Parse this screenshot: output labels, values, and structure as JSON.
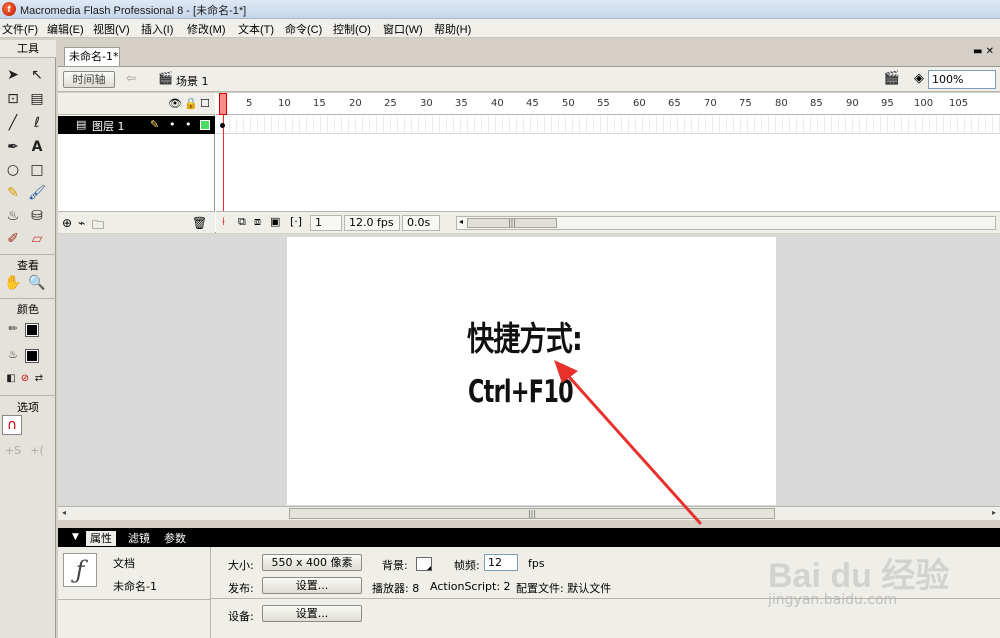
{
  "window": {
    "title": "Macromedia Flash Professional 8 - [未命名-1*]",
    "app_icon_letter": "f"
  },
  "menu": [
    "文件(F)",
    "编辑(E)",
    "视图(V)",
    "插入(I)",
    "修改(M)",
    "文本(T)",
    "命令(C)",
    "控制(O)",
    "窗口(W)",
    "帮助(H)"
  ],
  "tools": {
    "header": "工具",
    "view_header": "查看",
    "color_header": "颜色",
    "options_header": "选项"
  },
  "document": {
    "tab": "未命名-1*",
    "timeline_button": "时间轴",
    "scene": "场景 1",
    "zoom": "100%"
  },
  "timeline": {
    "layer_name": "图层 1",
    "ruler": [
      "1",
      "5",
      "10",
      "15",
      "20",
      "25",
      "30",
      "35",
      "40",
      "45",
      "50",
      "55",
      "60",
      "65",
      "70",
      "75",
      "80",
      "85",
      "90",
      "95",
      "100",
      "105"
    ],
    "current_frame": "1",
    "frame_rate": "12.0 fps",
    "elapsed": "0.0s"
  },
  "stage": {
    "line1": "快捷方式:",
    "line2": "Ctrl+F10"
  },
  "properties": {
    "tabs": [
      "属性",
      "滤镜",
      "参数"
    ],
    "kind": "文档",
    "doc_name": "未命名-1",
    "size_label": "大小:",
    "size_value": "550 x 400 像素",
    "background_label": "背景:",
    "fps_label": "帧频:",
    "fps_value": "12",
    "fps_unit": "fps",
    "publish_label": "发布:",
    "settings_button": "设置...",
    "player": "播放器: 8",
    "actionscript": "ActionScript:  2",
    "profile": "配置文件:  默认文件",
    "device_label": "设备:",
    "device_button": "设置..."
  },
  "watermark": {
    "logo": "Bai du 经验",
    "url": "jingyan.baidu.com"
  },
  "colors": {
    "annotation_arrow": "#e8302c",
    "layer_outline": "#4cd964"
  }
}
